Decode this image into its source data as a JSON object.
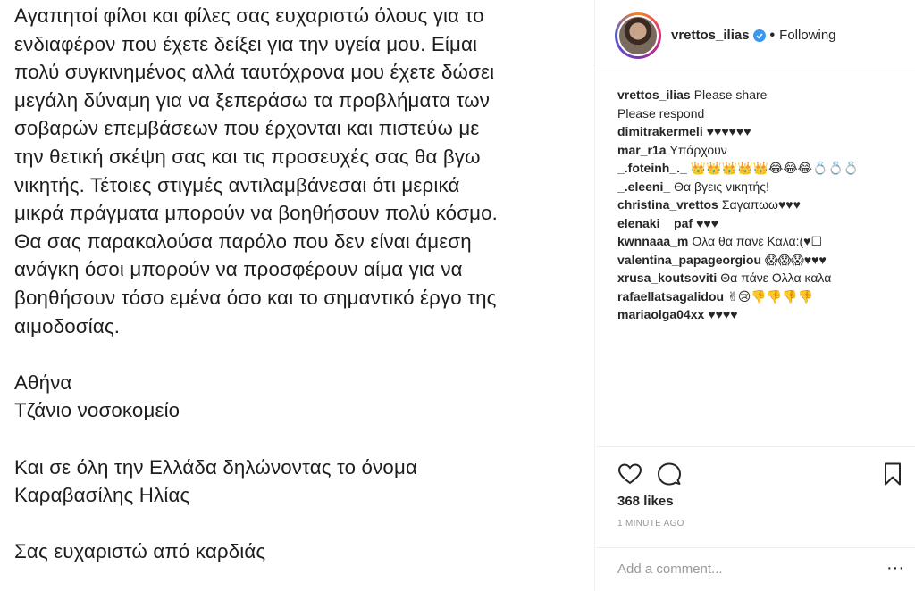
{
  "post": {
    "paragraphs": [
      [
        "Αγαπητοί φίλοι και φίλες σας ευχαριστώ όλους  για το",
        "ενδιαφέρον που έχετε δείξει για την υγεία μου. Είμαι",
        "πολύ συγκινημένος αλλά ταυτόχρονα μου έχετε δώσει",
        "μεγάλη δύναμη για να ξεπεράσω τα προβλήματα των",
        "σοβαρών επεμβάσεων που έρχονται και πιστεύω με",
        "την θετική σκέψη σας και τις προσευχές σας θα βγω",
        "νικητής. Τέτοιες στιγμές αντιλαμβάνεσαι ότι μερικά",
        "μικρά πράγματα μπορούν να βοηθήσουν πολύ κόσμο.",
        "Θα σας παρακαλούσα παρόλο που δεν είναι άμεση",
        "ανάγκη όσοι μπορούν να προσφέρουν αίμα για να",
        "βοηθήσουν τόσο εμένα όσο και το σημαντικό έργο της",
        "αιμοδοσίας."
      ],
      [
        "Αθήνα",
        "Τζάνιο νοσοκομείο"
      ],
      [
        "Και σε όλη την Ελλάδα δηλώνοντας το όνομα",
        "Καραβασίλης Ηλίας"
      ],
      [
        "Σας ευχαριστώ από καρδιάς"
      ]
    ]
  },
  "header": {
    "username": "vrettos_ilias",
    "separator": "•",
    "follow_status": "Following"
  },
  "comments": [
    {
      "user": "vrettos_ilias",
      "text": "Please share"
    },
    {
      "user": "",
      "text": "Please respond"
    },
    {
      "user": "dimitrakermeli",
      "text": "♥♥♥♥♥♥"
    },
    {
      "user": "mar_r1a",
      "text": "Υπάρχουν"
    },
    {
      "user": "_.foteinh_._",
      "text": "👑👑👑👑👑😂😂😂💍💍💍"
    },
    {
      "user": "_.eleeni_",
      "text": "Θα βγεις νικητής!"
    },
    {
      "user": "christina_vrettos",
      "text": "Σαγαπωω♥♥♥"
    },
    {
      "user": "elenaki__paf",
      "text": "♥♥♥"
    },
    {
      "user": "kwnnaaa_m",
      "text": "Ολα θα πανε Καλα:(♥☐"
    },
    {
      "user": "valentina_papageorgiou",
      "text": "😱😱😱♥♥♥"
    },
    {
      "user": "xrusa_koutsoviti",
      "text": "Θα πάνε Ολλα καλα"
    },
    {
      "user": "rafaellatsagalidou",
      "text": "✌😢👎👎👎👎"
    },
    {
      "user": "mariaolga04xx",
      "text": "♥♥♥♥"
    }
  ],
  "actions": {
    "likes": "368 likes",
    "time": "1 MINUTE AGO",
    "comment_placeholder": "Add a comment...",
    "more": "···"
  },
  "colors": {
    "verified": "#3897f0",
    "border": "#efefef",
    "muted": "#999999"
  }
}
